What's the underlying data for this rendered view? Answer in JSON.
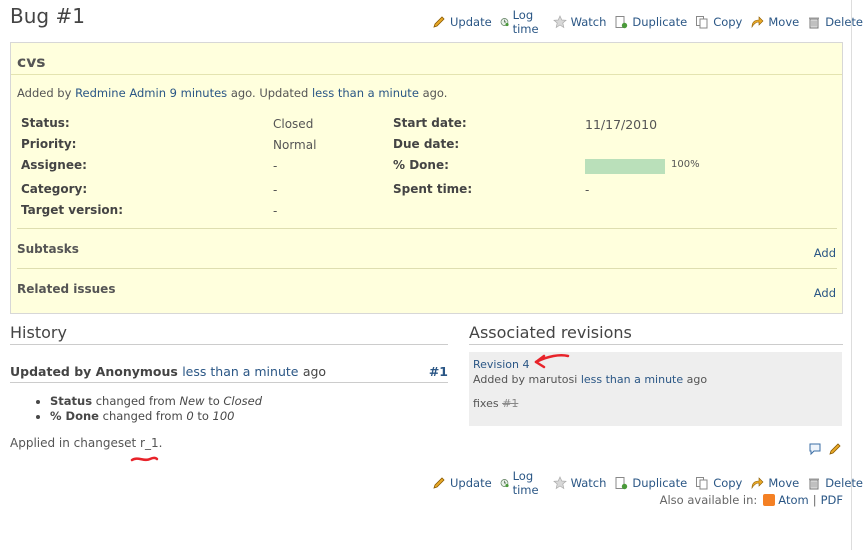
{
  "title": "Bug #1",
  "actions": [
    "Update",
    "Log time",
    "Watch",
    "Duplicate",
    "Copy",
    "Move",
    "Delete"
  ],
  "issue": {
    "subject": "cvs",
    "added_prefix": "Added by",
    "author": "Redmine Admin",
    "added_ago": "9 minutes",
    "updated_text": "ago. Updated",
    "updated_ago": "less than a minute",
    "ago_suffix": "ago.",
    "attributes": {
      "status_label": "Status:",
      "status_value": "Closed",
      "priority_label": "Priority:",
      "priority_value": "Normal",
      "assignee_label": "Assignee:",
      "assignee_value": "-",
      "category_label": "Category:",
      "category_value": "-",
      "target_label": "Target version:",
      "target_value": "-",
      "start_label": "Start date:",
      "start_value": "11/17/2010",
      "due_label": "Due date:",
      "due_value": "",
      "done_label": "% Done:",
      "done_value": "100%",
      "done_fraction": 1.0,
      "spent_label": "Spent time:",
      "spent_value": "-"
    },
    "subtasks_label": "Subtasks",
    "related_label": "Related issues",
    "add_label": "Add"
  },
  "history": {
    "heading": "History",
    "journal_prefix": "Updated by Anonymous",
    "journal_ago": "less than a minute",
    "journal_suffix": "ago",
    "journal_num": "#1",
    "details": [
      {
        "field": "Status",
        "mid": "changed from",
        "from": "New",
        "to_word": "to",
        "to": "Closed"
      },
      {
        "field": "% Done",
        "mid": "changed from",
        "from": "0",
        "to_word": "to",
        "to": "100"
      }
    ],
    "changeset_prefix": "Applied in changeset",
    "changeset_ref": "r_1",
    "changeset_suffix": "."
  },
  "revisions": {
    "heading": "Associated revisions",
    "revision_link": "Revision 4",
    "added_by": "Added by marutosi",
    "ago": "less than a minute",
    "ago_suffix": "ago",
    "comment": "fixes",
    "comment_ref": "#1"
  },
  "footer": {
    "available": "Also available in:",
    "atom": "Atom",
    "pipe": "|",
    "pdf": "PDF"
  },
  "colors": {
    "link": "#2A5685",
    "issue_bg": "#FFFFDD",
    "progress_done": "#BAE0BA",
    "annotation": "#E8232A"
  }
}
